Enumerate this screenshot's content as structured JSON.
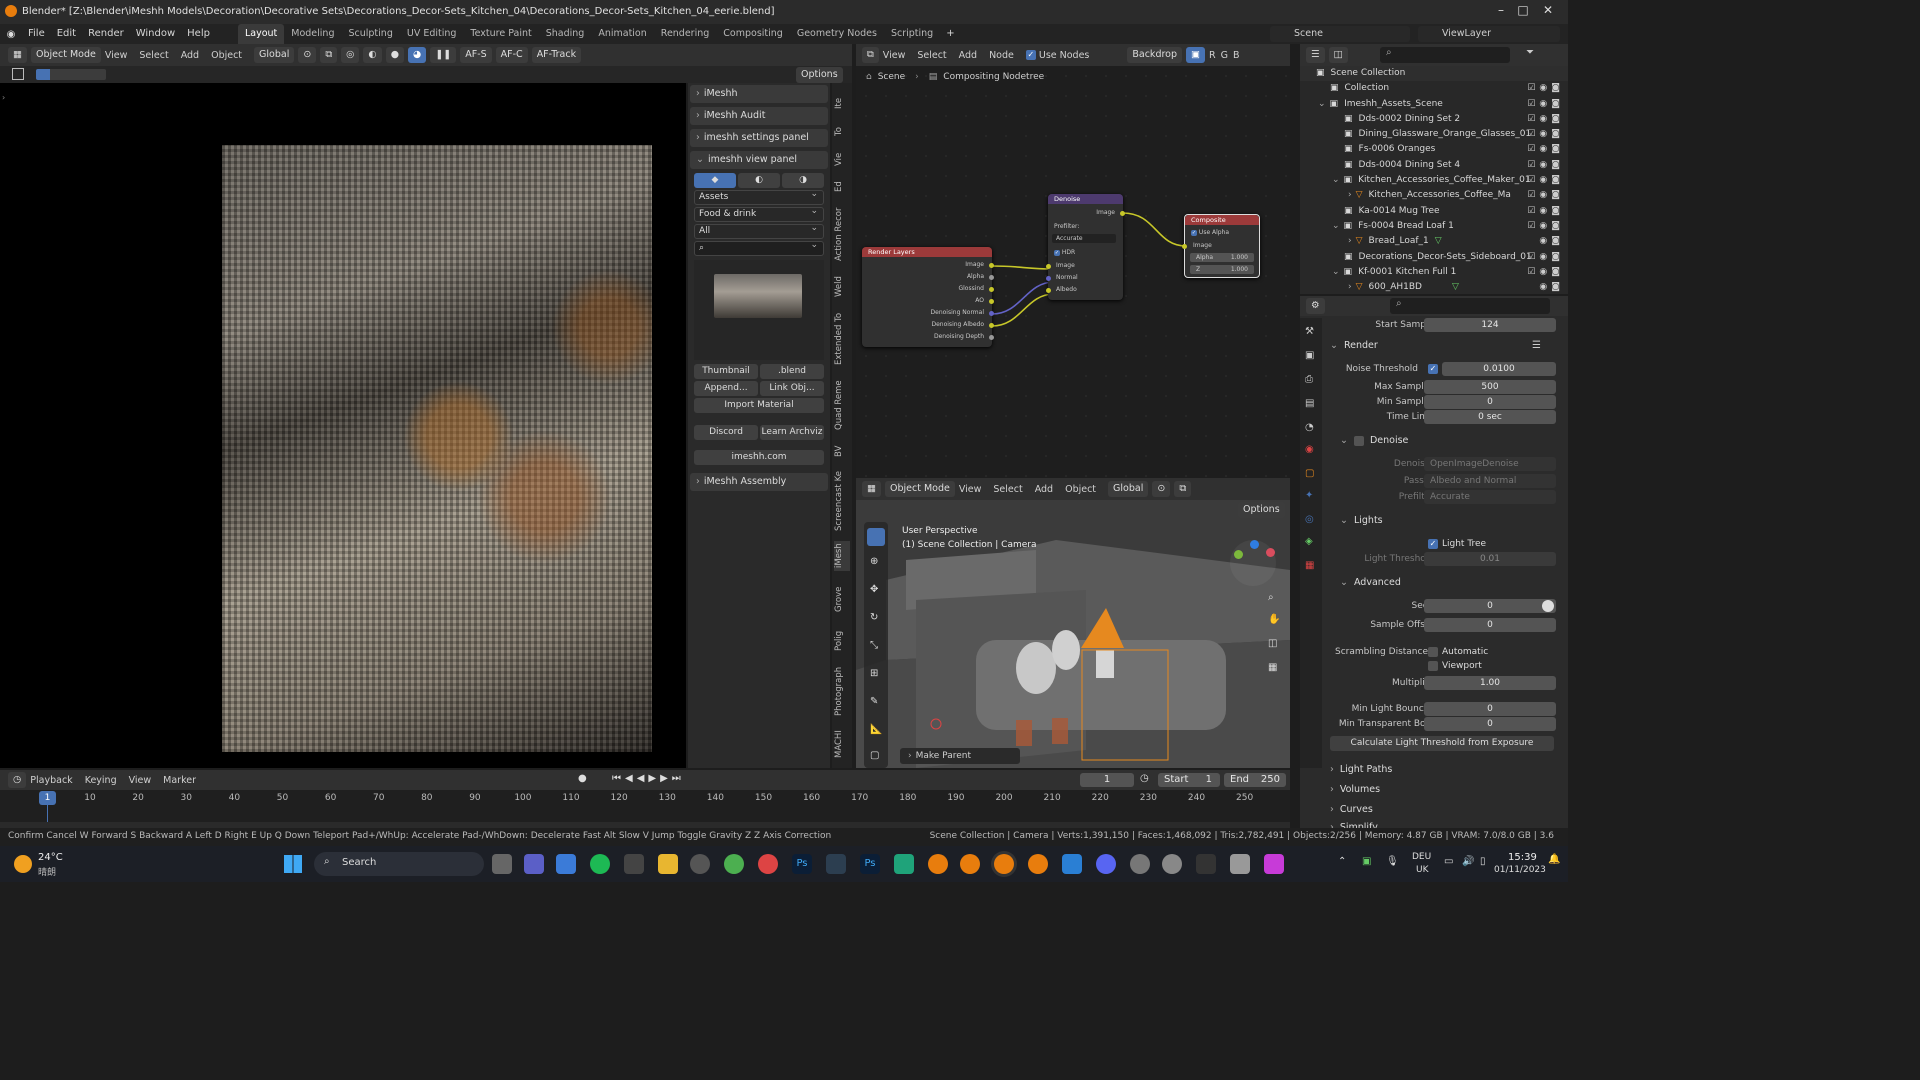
{
  "window": {
    "title": "Blender* [Z:\\Blender\\iMeshh Models\\Decoration\\Decorative Sets\\Decorations_Decor-Sets_Kitchen_04\\Decorations_Decor-Sets_Kitchen_04_eerie.blend]"
  },
  "menu": [
    "File",
    "Edit",
    "Render",
    "Window",
    "Help"
  ],
  "workspaces": [
    "Layout",
    "Modeling",
    "Sculpting",
    "UV Editing",
    "Texture Paint",
    "Shading",
    "Animation",
    "Rendering",
    "Compositing",
    "Geometry Nodes",
    "Scripting"
  ],
  "top_right": {
    "scene": "Scene",
    "view_layer": "ViewLayer"
  },
  "left_view_header": {
    "mode": "Object Mode",
    "menus": [
      "View",
      "Select",
      "Add",
      "Object"
    ],
    "orientation": "Global",
    "af_s": "AF-S",
    "af_c": "AF-C",
    "af_track": "AF-Track",
    "options": "Options"
  },
  "npanel": {
    "sections": [
      "iMeshh",
      "iMeshh Audit",
      "imeshh settings panel",
      "imeshh view panel"
    ],
    "drop_assets": "Assets",
    "drop_category": "Food & drink",
    "drop_filter": "All",
    "thumbnail_label": "Thumbnail",
    "blend_label": ".blend",
    "append_label": "Append...",
    "link_label": "Link Obj...",
    "import_material": "Import Material",
    "discord": "Discord",
    "learn": "Learn Archviz",
    "site": "imeshh.com",
    "assembly": "iMeshh Assembly"
  },
  "vtabs": [
    "Ite",
    "To",
    "Vie",
    "Ed",
    "Action Recor",
    "Weld",
    "Extended To",
    "Quad Reme",
    "BV",
    "Screencast Ke",
    "iMesh",
    "Grove",
    "Polig",
    "Photograph",
    "MACHI"
  ],
  "node_editor": {
    "menus": [
      "View",
      "Select",
      "Add",
      "Node"
    ],
    "use_nodes": "Use Nodes",
    "backdrop": "Backdrop",
    "channels": [
      "R",
      "G",
      "B"
    ],
    "breadcrumb_scene": "Scene",
    "breadcrumb_tree": "Compositing Nodetree",
    "render_layers": {
      "title": "Render Layers",
      "outputs": [
        "Image",
        "Alpha",
        "Glossind",
        "AO",
        "Denoising Normal",
        "Denoising Albedo",
        "Denoising Depth"
      ]
    },
    "denoise": {
      "title": "Denoise",
      "out": "Image",
      "prefilter_label": "Prefilter:",
      "prefilter": "Accurate",
      "hdr": "HDR",
      "inputs": [
        "Image",
        "Normal",
        "Albedo"
      ]
    },
    "composite": {
      "title": "Composite",
      "use_alpha": "Use Alpha",
      "input": "Image",
      "alpha_label": "Alpha",
      "alpha_value": "1.000",
      "z_label": "Z",
      "z_value": "1.000"
    }
  },
  "viewport3d": {
    "mode": "Object Mode",
    "menus": [
      "View",
      "Select",
      "Add",
      "Object"
    ],
    "orientation": "Global",
    "options": "Options",
    "perspective": "User Perspective",
    "collection": "(1) Scene Collection | Camera",
    "make_parent": "Make Parent"
  },
  "outliner": {
    "rows": [
      {
        "label": "Scene Collection",
        "indent": 0
      },
      {
        "label": "Collection",
        "indent": 1
      },
      {
        "label": "Imeshh_Assets_Scene",
        "indent": 1
      },
      {
        "label": "Dds-0002 Dining Set 2",
        "indent": 2
      },
      {
        "label": "Dining_Glassware_Orange_Glasses_01",
        "indent": 2
      },
      {
        "label": "Fs-0006 Oranges",
        "indent": 2
      },
      {
        "label": "Dds-0004 Dining Set 4",
        "indent": 2
      },
      {
        "label": "Kitchen_Accessories_Coffee_Maker_01",
        "indent": 2
      },
      {
        "label": "Kitchen_Accessories_Coffee_Ma",
        "indent": 3
      },
      {
        "label": "Ka-0014 Mug Tree",
        "indent": 2
      },
      {
        "label": "Fs-0004 Bread Loaf 1",
        "indent": 2
      },
      {
        "label": "Bread_Loaf_1",
        "indent": 3
      },
      {
        "label": "Decorations_Decor-Sets_Sideboard_01",
        "indent": 2
      },
      {
        "label": "Kf-0001 Kitchen Full 1",
        "indent": 2
      },
      {
        "label": "600_AH1BD",
        "indent": 3
      }
    ]
  },
  "properties": {
    "start_sample_label": "Start Sample",
    "start_sample": "124",
    "render_section": "Render",
    "noise_threshold_label": "Noise Threshold",
    "noise_threshold": "0.0100",
    "max_samples_label": "Max Samples",
    "max_samples": "500",
    "min_samples_label": "Min Samples",
    "min_samples": "0",
    "time_limit_label": "Time Limit",
    "time_limit": "0 sec",
    "denoise_section": "Denoise",
    "denoiser_label": "Denoiser",
    "denoiser": "OpenImageDenoise",
    "passes_label": "Passes",
    "passes": "Albedo and Normal",
    "prefilter_label": "Prefilter",
    "prefilter": "Accurate",
    "lights_section": "Lights",
    "light_tree": "Light Tree",
    "light_threshold_label": "Light Threshold",
    "light_threshold": "0.01",
    "advanced_section": "Advanced",
    "seed_label": "Seed",
    "seed": "0",
    "sample_offset_label": "Sample Offset",
    "sample_offset": "0",
    "scrambling_label": "Scrambling Distance",
    "automatic": "Automatic",
    "viewport": "Viewport",
    "multiplier_label": "Multiplier",
    "multiplier": "1.00",
    "min_light_bounces_label": "Min Light Bounces",
    "min_light_bounces": "0",
    "min_transparent_label": "Min Transparent Bo...",
    "min_transparent": "0",
    "calc_button": "Calculate Light Threshold from Exposure",
    "light_paths": "Light Paths",
    "volumes": "Volumes",
    "curves": "Curves",
    "simplify": "Simplify"
  },
  "timeline": {
    "menus": [
      "Playback",
      "Keying",
      "View",
      "Marker"
    ],
    "current_frame": "1",
    "start_label": "Start",
    "start": "1",
    "end_label": "End",
    "end": "250",
    "ticks": [
      "10",
      "20",
      "30",
      "40",
      "50",
      "60",
      "70",
      "80",
      "90",
      "100",
      "110",
      "120",
      "130",
      "140",
      "150",
      "160",
      "170",
      "180",
      "190",
      "200",
      "210",
      "220",
      "230",
      "240",
      "250"
    ],
    "playhead": "1"
  },
  "statusbar": {
    "hints": "Confirm   Cancel  W Forward  S Backward  A Left  D Right  E Up  Q Down   Teleport  Pad+/WhUp: Accelerate  Pad-/WhDown: Decelerate   Fast  Alt Slow  V Jump   Toggle Gravity  Z  Z Axis Correction",
    "stats": "Scene Collection | Camera | Verts:1,391,150 | Faces:1,468,092 | Tris:2,782,491 | Objects:2/256 | Memory: 4.87 GB | VRAM: 7.0/8.0 GB | 3.6"
  },
  "taskbar": {
    "temp": "24°C",
    "weather": "晴朗",
    "search": "Search",
    "lang1": "DEU",
    "lang2": "UK",
    "time": "15:39",
    "date": "01/11/2023"
  },
  "colors": {
    "accent": "#4772b3",
    "node_render_layers": "#9c3a3a",
    "node_denoise": "#4d3a6e",
    "node_composite": "#9c3a3a",
    "socket_yellow": "#c7c729",
    "socket_purple": "#6363c7",
    "camera_orange": "#e6891f"
  }
}
